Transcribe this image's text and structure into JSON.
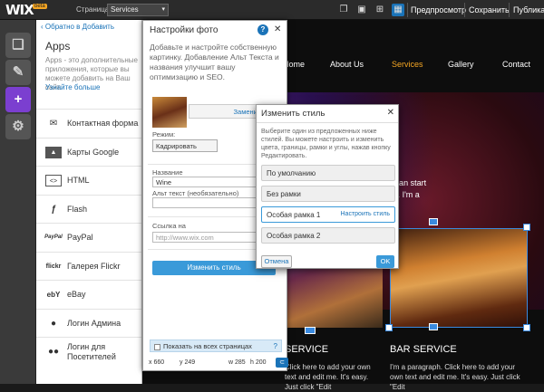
{
  "topbar": {
    "logo": "WIX",
    "beta": "beta",
    "page_label": "Страница:",
    "page_value": "Services",
    "preview": "Предпросмотр",
    "save": "Сохранить",
    "publish": "Публикация"
  },
  "site": {
    "nav": [
      "Home",
      "About Us",
      "Services",
      "Gallery",
      "Contact"
    ],
    "active_nav": "Services",
    "hero_text": "or double click me and you can start\nwhere you like on your page. I'm a",
    "services_title": "SERVICE",
    "bar_title": "BAR SERVICE",
    "services_para": "Click here to add your own text and edit me. It's easy. Just click \"Edit",
    "bar_para": "I'm a paragraph. Click here to add your own text and edit me. It's easy. Just click \"Edit"
  },
  "rail": {
    "items": [
      "pages-icon",
      "design-icon",
      "add-icon",
      "settings-icon"
    ],
    "active": "add-icon"
  },
  "apps": {
    "back": "‹ Обратно в Добавить",
    "title": "Apps",
    "desc": "Apps - это дополнительные приложения, которые вы можете добавить на Ваш сайт.",
    "more": "Узнайте больше",
    "items": [
      {
        "label": "Контактная форма",
        "icon": "envelope-icon"
      },
      {
        "label": "Карты Google",
        "icon": "map-icon"
      },
      {
        "label": "HTML",
        "icon": "code-icon"
      },
      {
        "label": "Flash",
        "icon": "flash-icon"
      },
      {
        "label": "PayPal",
        "icon": "paypal-icon"
      },
      {
        "label": "Галерея Flickr",
        "icon": "flickr-icon"
      },
      {
        "label": "eBay",
        "icon": "ebay-icon"
      },
      {
        "label": "Логин Админа",
        "icon": "user-icon"
      },
      {
        "label": "Логин для\nПосетителей",
        "icon": "users-icon"
      }
    ]
  },
  "photo_panel": {
    "title": "Настройки фото",
    "desc": "Добавьте и настройте собственную картинку. Добавление Альт Текста и названия улучшит вашу оптимизацию и SEO.",
    "change_photo": "Заменить фото",
    "mode_label": "Режим:",
    "mode_value": "Кадрировать",
    "name_label": "Название",
    "name_value": "Wine",
    "alt_label": "Альт текст (необязательно)",
    "alt_value": "",
    "link_label": "Ссылка на",
    "link_placeholder": "http://www.wix.com",
    "change_style": "Изменить стиль",
    "show_all": "Показать на всех страницах",
    "x": "x 660",
    "y": "y 249",
    "w": "w 285",
    "h": "h 200"
  },
  "style_dialog": {
    "title": "Изменить стиль",
    "desc": "Выберите один из предложенных ниже стилей. Вы можете настроить и изменить цвета, границы, рамки и углы, нажав кнопку Редактировать.",
    "options": [
      "По умолчанию",
      "Без рамки",
      "Особая рамка 1",
      "Особая рамка 2"
    ],
    "selected": "Особая рамка 1",
    "customize": "Настроить стиль",
    "cancel": "Отмена",
    "ok": "OK"
  },
  "colors": {
    "accent": "#1a73b8",
    "purple": "#7b3fd0",
    "nav_active": "#f5a623"
  }
}
